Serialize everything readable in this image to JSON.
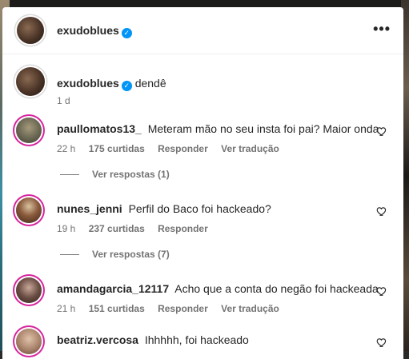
{
  "post": {
    "author": "exudoblues",
    "caption_author": "exudoblues",
    "caption_text": "dendê",
    "caption_time": "1 d",
    "more_icon": "•••"
  },
  "comments": [
    {
      "username": "paullomatos13_",
      "text": "Meteram mão no seu insta foi pai? Maior onda",
      "time": "22 h",
      "likes": "175 curtidas",
      "reply": "Responder",
      "translate": "Ver tradução",
      "replies": "Ver respostas (1)"
    },
    {
      "username": "nunes_jenni",
      "text": "Perfil do Baco foi hackeado?",
      "time": "19 h",
      "likes": "237 curtidas",
      "reply": "Responder",
      "replies": "Ver respostas (7)"
    },
    {
      "username": "amandagarcia_12117",
      "text": "Acho que a conta do negão foi hackeada",
      "time": "21 h",
      "likes": "151 curtidas",
      "reply": "Responder",
      "translate": "Ver tradução"
    },
    {
      "username": "beatriz.vercosa",
      "text": "Ihhhhh, foi hackeado"
    }
  ],
  "colors": {
    "text": "#262626",
    "secondary": "#737373",
    "verified": "#0095f6",
    "story_ring": "#d6249f"
  },
  "icons": {
    "verified": "verified-badge-icon",
    "like": "heart-icon",
    "more": "more-options-icon"
  }
}
